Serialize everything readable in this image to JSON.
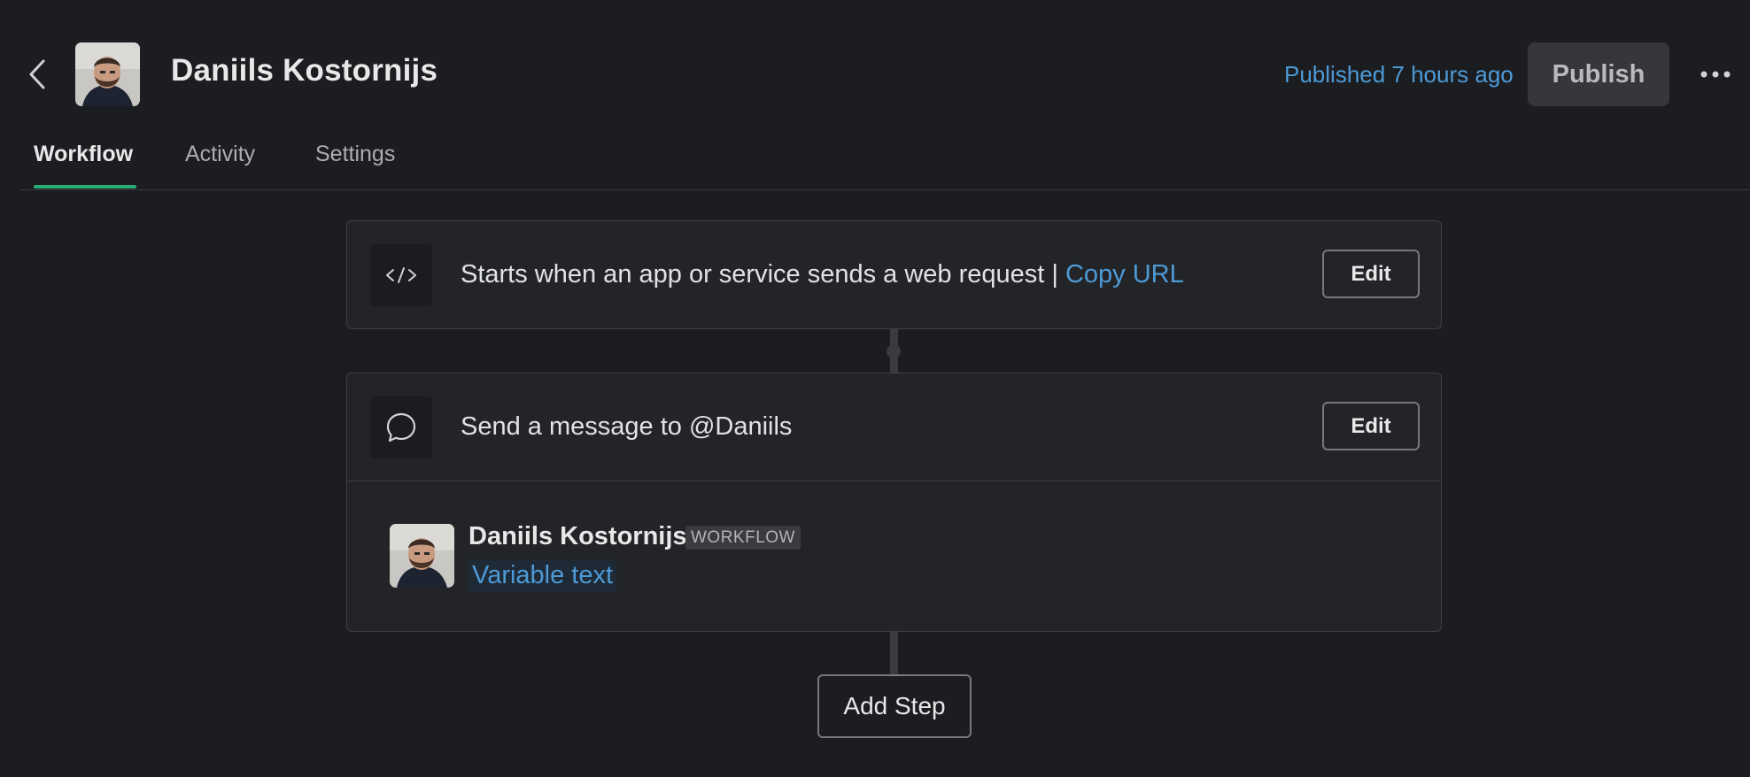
{
  "header": {
    "title": "Daniils Kostornijs",
    "published_text": "Published 7 hours ago",
    "publish_label": "Publish"
  },
  "tabs": [
    {
      "label": "Workflow",
      "active": true
    },
    {
      "label": "Activity",
      "active": false
    },
    {
      "label": "Settings",
      "active": false
    }
  ],
  "trigger": {
    "text": "Starts when an app or service sends a web request |",
    "link": "Copy URL",
    "edit_label": "Edit",
    "icon": "code-icon"
  },
  "message_step": {
    "text": "Send a message to @Daniils",
    "edit_label": "Edit",
    "icon": "message-bubble-icon",
    "preview": {
      "sender": "Daniils Kostornijs",
      "badge": "WORKFLOW",
      "variable": "Variable text"
    }
  },
  "add_step_label": "Add Step",
  "colors": {
    "background": "#1b1d21",
    "card": "#222428",
    "link": "#4e9ad6",
    "tab_accent": "#2bac76"
  }
}
